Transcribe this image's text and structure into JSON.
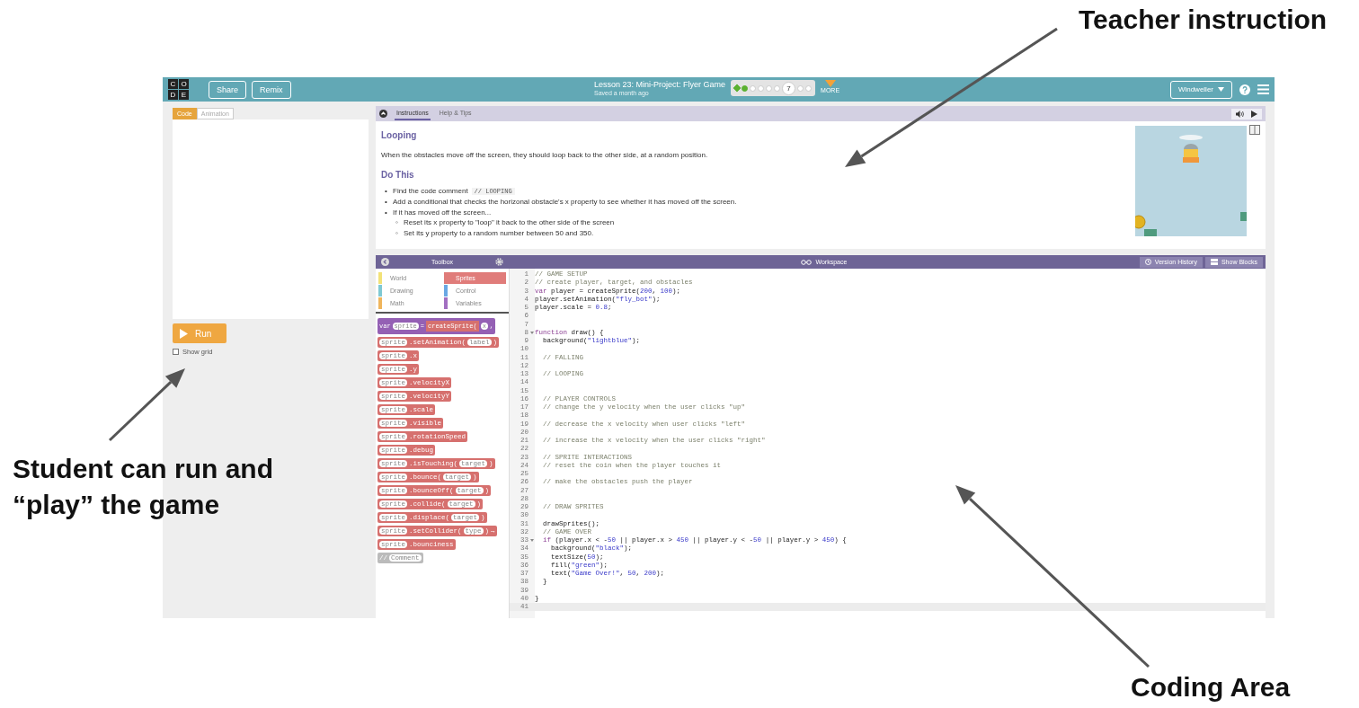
{
  "annotations": [
    {
      "text": "Teacher instruction"
    },
    {
      "text": "Student can run and “play” the game"
    },
    {
      "text": "Coding Area"
    }
  ],
  "header": {
    "logo": [
      "C",
      "O",
      "D",
      "E"
    ],
    "buttons": [
      "Share",
      "Remix"
    ],
    "title": "Lesson 23: Mini-Project: Flyer Game",
    "saved": "Saved a month ago",
    "progress": [
      {
        "kind": "diamond",
        "done": true
      },
      {
        "kind": "dot",
        "done": true
      },
      {
        "kind": "dot",
        "done": false
      },
      {
        "kind": "dot",
        "done": false
      },
      {
        "kind": "dot",
        "done": false
      },
      {
        "kind": "dot",
        "done": false
      },
      {
        "kind": "current",
        "label": "7"
      },
      {
        "kind": "dot",
        "done": false
      },
      {
        "kind": "dot",
        "done": false
      }
    ],
    "more": "MORE",
    "user": "Windweller"
  },
  "left": {
    "tabs": [
      {
        "label": "Code",
        "selected": true
      },
      {
        "label": "Animation",
        "selected": false
      }
    ],
    "run": "Run",
    "show_grid": {
      "label": "Show grid",
      "checked": false
    }
  },
  "instructions": {
    "tabs": [
      {
        "label": "Instructions",
        "selected": true
      },
      {
        "label": "Help & Tips",
        "selected": false
      }
    ],
    "heading": "Looping",
    "intro": "When the obstacles move off the screen, they should loop back to the other side, at a random position.",
    "do_this": "Do This",
    "bullets": [
      {
        "marker": "•",
        "text": "Find the code comment",
        "code": "// LOOPING"
      },
      {
        "marker": "•",
        "text": "Add a conditional that checks the horizonal obstacle's x property to see whether it has moved off the screen."
      },
      {
        "marker": "•",
        "text": "If it has moved off the screen...",
        "children": [
          {
            "marker": "◦",
            "text": "Reset its x property to \"loop\" it back to the other side of the screen"
          },
          {
            "marker": "◦",
            "text": "Set its y property to a random number between 50 and 350."
          }
        ]
      }
    ]
  },
  "workspace": {
    "toolbox": "Toolbox",
    "title": "Workspace",
    "buttons": [
      "Version History",
      "Show Blocks"
    ],
    "categories": [
      {
        "label": "World",
        "color": "#f2e278",
        "selected": false
      },
      {
        "label": "Sprites",
        "color": "#e07c7a",
        "selected": true
      },
      {
        "label": "Drawing",
        "color": "#7fc9d3",
        "selected": false
      },
      {
        "label": "Control",
        "color": "#6aa8e4",
        "selected": false
      },
      {
        "label": "Math",
        "color": "#efb55c",
        "selected": false
      },
      {
        "label": "Variables",
        "color": "#a26fc1",
        "selected": false
      }
    ],
    "blocks": [
      {
        "kind": "var",
        "parts": [
          {
            "kind": "text",
            "t": "var"
          },
          {
            "kind": "slot",
            "t": "sprite"
          },
          {
            "kind": "text",
            "t": "="
          },
          {
            "kind": "inner",
            "t": "createSprite("
          },
          {
            "kind": "slot",
            "t": "x"
          },
          {
            "kind": "text",
            "t": ","
          }
        ]
      },
      {
        "kind": "sprite",
        "parts": [
          {
            "kind": "slot",
            "t": "sprite"
          },
          {
            "kind": "text",
            "t": ".setAnimation("
          },
          {
            "kind": "slot",
            "t": "label"
          },
          {
            "kind": "text",
            "t": ")"
          }
        ]
      },
      {
        "kind": "sprite",
        "parts": [
          {
            "kind": "slot",
            "t": "sprite"
          },
          {
            "kind": "text",
            "t": ".x"
          }
        ]
      },
      {
        "kind": "sprite",
        "parts": [
          {
            "kind": "slot",
            "t": "sprite"
          },
          {
            "kind": "text",
            "t": ".y"
          }
        ]
      },
      {
        "kind": "sprite",
        "parts": [
          {
            "kind": "slot",
            "t": "sprite"
          },
          {
            "kind": "text",
            "t": ".velocityX"
          }
        ]
      },
      {
        "kind": "sprite",
        "parts": [
          {
            "kind": "slot",
            "t": "sprite"
          },
          {
            "kind": "text",
            "t": ".velocityY"
          }
        ]
      },
      {
        "kind": "sprite",
        "parts": [
          {
            "kind": "slot",
            "t": "sprite"
          },
          {
            "kind": "text",
            "t": ".scale"
          }
        ]
      },
      {
        "kind": "sprite",
        "parts": [
          {
            "kind": "slot",
            "t": "sprite"
          },
          {
            "kind": "text",
            "t": ".visible"
          }
        ]
      },
      {
        "kind": "sprite",
        "parts": [
          {
            "kind": "slot",
            "t": "sprite"
          },
          {
            "kind": "text",
            "t": ".rotationSpeed"
          }
        ]
      },
      {
        "kind": "sprite",
        "parts": [
          {
            "kind": "slot",
            "t": "sprite"
          },
          {
            "kind": "text",
            "t": ".debug"
          }
        ]
      },
      {
        "kind": "sprite",
        "parts": [
          {
            "kind": "slot",
            "t": "sprite"
          },
          {
            "kind": "text",
            "t": ".isTouching("
          },
          {
            "kind": "slot",
            "t": "target"
          },
          {
            "kind": "text",
            "t": ")"
          }
        ]
      },
      {
        "kind": "sprite",
        "parts": [
          {
            "kind": "slot",
            "t": "sprite"
          },
          {
            "kind": "text",
            "t": ".bounce("
          },
          {
            "kind": "slot",
            "t": "target"
          },
          {
            "kind": "text",
            "t": ")"
          }
        ]
      },
      {
        "kind": "sprite",
        "parts": [
          {
            "kind": "slot",
            "t": "sprite"
          },
          {
            "kind": "text",
            "t": ".bounceOff("
          },
          {
            "kind": "slot",
            "t": "target"
          },
          {
            "kind": "text",
            "t": ")"
          }
        ]
      },
      {
        "kind": "sprite",
        "parts": [
          {
            "kind": "slot",
            "t": "sprite"
          },
          {
            "kind": "text",
            "t": ".collide("
          },
          {
            "kind": "slot",
            "t": "target"
          },
          {
            "kind": "text",
            "t": ")"
          }
        ]
      },
      {
        "kind": "sprite",
        "parts": [
          {
            "kind": "slot",
            "t": "sprite"
          },
          {
            "kind": "text",
            "t": ".displace("
          },
          {
            "kind": "slot",
            "t": "target"
          },
          {
            "kind": "text",
            "t": ")"
          }
        ]
      },
      {
        "kind": "sprite",
        "parts": [
          {
            "kind": "slot",
            "t": "sprite"
          },
          {
            "kind": "text",
            "t": ".setCollider("
          },
          {
            "kind": "slot",
            "t": "type"
          },
          {
            "kind": "text",
            "t": ")"
          },
          {
            "kind": "text",
            "t": "→"
          }
        ]
      },
      {
        "kind": "sprite",
        "parts": [
          {
            "kind": "slot",
            "t": "sprite"
          },
          {
            "kind": "text",
            "t": ".bounciness"
          }
        ]
      },
      {
        "kind": "comment",
        "parts": [
          {
            "kind": "text",
            "t": "//"
          },
          {
            "kind": "slot",
            "t": "Comment"
          }
        ]
      }
    ],
    "code": [
      {
        "n": "1",
        "text": "// GAME SETUP",
        "active": false
      },
      {
        "n": "2",
        "text": "// create player, target, and obstacles",
        "active": false
      },
      {
        "n": "3",
        "text": "var player = createSprite(200, 100);",
        "active": false
      },
      {
        "n": "4",
        "text": "player.setAnimation(\"fly_bot\");",
        "active": false
      },
      {
        "n": "5",
        "text": "player.scale = 0.8;",
        "active": false
      },
      {
        "n": "6",
        "active": false
      },
      {
        "n": "7",
        "active": false
      },
      {
        "n": "8",
        "text": "function draw() {",
        "fold": true,
        "active": false
      },
      {
        "n": "9",
        "text": "  background(\"lightblue\");",
        "active": false
      },
      {
        "n": "10",
        "active": false
      },
      {
        "n": "11",
        "text": "  // FALLING",
        "active": false
      },
      {
        "n": "12",
        "active": false
      },
      {
        "n": "13",
        "text": "  // LOOPING",
        "active": false
      },
      {
        "n": "14",
        "active": false
      },
      {
        "n": "15",
        "active": false
      },
      {
        "n": "16",
        "text": "  // PLAYER CONTROLS",
        "active": false
      },
      {
        "n": "17",
        "text": "  // change the y velocity when the user clicks \"up\"",
        "active": false
      },
      {
        "n": "18",
        "active": false
      },
      {
        "n": "19",
        "text": "  // decrease the x velocity when user clicks \"left\"",
        "active": false
      },
      {
        "n": "20",
        "active": false
      },
      {
        "n": "21",
        "text": "  // increase the x velocity when the user clicks \"right\"",
        "active": false
      },
      {
        "n": "22",
        "active": false
      },
      {
        "n": "23",
        "text": "  // SPRITE INTERACTIONS",
        "active": false
      },
      {
        "n": "24",
        "text": "  // reset the coin when the player touches it",
        "active": false
      },
      {
        "n": "25",
        "active": false
      },
      {
        "n": "26",
        "text": "  // make the obstacles push the player",
        "active": false
      },
      {
        "n": "27",
        "active": false
      },
      {
        "n": "28",
        "active": false
      },
      {
        "n": "29",
        "text": "  // DRAW SPRITES",
        "active": false
      },
      {
        "n": "30",
        "active": false
      },
      {
        "n": "31",
        "text": "  drawSprites();",
        "active": false
      },
      {
        "n": "32",
        "text": "  // GAME OVER",
        "active": false
      },
      {
        "n": "33",
        "text": "  if (player.x < -50 || player.x > 450 || player.y < -50 || player.y > 450) {",
        "fold": true,
        "active": false
      },
      {
        "n": "34",
        "text": "    background(\"black\");",
        "active": false
      },
      {
        "n": "35",
        "text": "    textSize(50);",
        "active": false
      },
      {
        "n": "36",
        "text": "    fill(\"green\");",
        "active": false
      },
      {
        "n": "37",
        "text": "    text(\"Game Over!\", 50, 200);",
        "active": false
      },
      {
        "n": "38",
        "text": "  }",
        "active": false
      },
      {
        "n": "39",
        "active": false
      },
      {
        "n": "40",
        "text": "}",
        "active": false
      },
      {
        "n": "41",
        "active": true
      }
    ]
  }
}
